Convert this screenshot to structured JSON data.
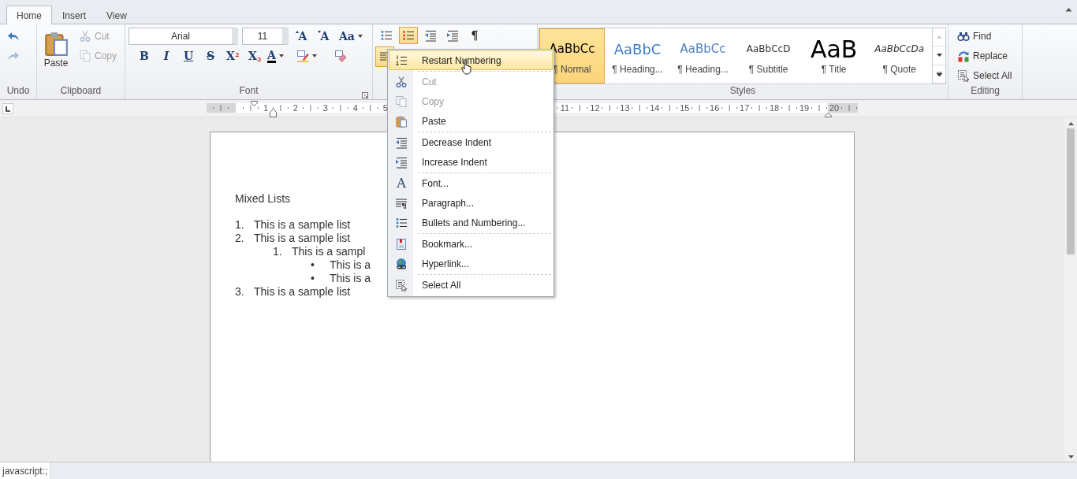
{
  "tabs": [
    {
      "label": "Home",
      "selected": true
    },
    {
      "label": "Insert",
      "selected": false
    },
    {
      "label": "View",
      "selected": false
    }
  ],
  "ribbon": {
    "undo": {
      "label": "Undo",
      "buttons": [
        {
          "kind": "undo",
          "disabled": false
        },
        {
          "kind": "redo",
          "disabled": true
        }
      ]
    },
    "clipboard": {
      "label": "Clipboard",
      "paste": {
        "label": "Paste"
      },
      "buttons": [
        {
          "kind": "cut",
          "label": "Cut",
          "disabled": true
        },
        {
          "kind": "copy",
          "label": "Copy",
          "disabled": true
        }
      ]
    },
    "font": {
      "label": "Font",
      "font_name": "Arial",
      "font_size": "11",
      "row1": [
        {
          "kind": "grow",
          "label": "A"
        },
        {
          "kind": "shrink",
          "label": "A"
        },
        {
          "kind": "case",
          "label": "Aa"
        }
      ],
      "row2": [
        {
          "kind": "bold",
          "label": "B"
        },
        {
          "kind": "italic",
          "label": "I"
        },
        {
          "kind": "underline",
          "label": "U"
        },
        {
          "kind": "strike",
          "label": "S"
        },
        {
          "kind": "super",
          "label": "X$^{2}$"
        },
        {
          "kind": "sub",
          "label": "X$_{2}$"
        },
        {
          "kind": "color",
          "label": "A"
        },
        {
          "kind": "highlight"
        },
        {
          "kind": "clear"
        }
      ]
    },
    "paragraph": {
      "row1": [
        {
          "kind": "bullets",
          "selected": false
        },
        {
          "kind": "numbering",
          "selected": true
        },
        {
          "kind": "outdent",
          "selected": false
        },
        {
          "kind": "indent",
          "selected": false
        },
        {
          "kind": "pilcrow",
          "label": "¶",
          "selected": false
        }
      ],
      "row2": [
        {
          "kind": "align-left",
          "selected": true
        }
      ]
    },
    "styles": {
      "label": "Styles",
      "items": [
        {
          "kind": "normal",
          "preview": "AaBbCc",
          "name": "¶ Normal",
          "selected": true
        },
        {
          "kind": "heading1",
          "preview": "AaBbC",
          "name": "¶ Heading...",
          "selected": false
        },
        {
          "kind": "heading2",
          "preview": "AaBbCc",
          "name": "¶ Heading...",
          "selected": false
        },
        {
          "kind": "subtitle",
          "preview": "AaBbCcD",
          "name": "¶ Subtitle",
          "selected": false
        },
        {
          "kind": "title",
          "preview": "AaB",
          "name": "¶ Title",
          "selected": false
        },
        {
          "kind": "quote",
          "preview": "AaBbCcDa",
          "name": "¶ Quote",
          "selected": false
        }
      ]
    },
    "editing": {
      "label": "Editing",
      "buttons": [
        {
          "kind": "find",
          "label": "Find"
        },
        {
          "kind": "replace",
          "label": "Replace"
        },
        {
          "kind": "selectall",
          "label": "Select All"
        }
      ]
    }
  },
  "ruler": {
    "left_numbers": [
      "1",
      "2",
      "3",
      "4",
      "5"
    ],
    "right_numbers": [
      "11",
      "12",
      "13",
      "14",
      "15",
      "16",
      "17",
      "18",
      "19",
      "20"
    ]
  },
  "document": {
    "title": "Mixed Lists",
    "list": [
      {
        "marker": "1.",
        "text": "This is a sample list"
      },
      {
        "marker": "2.",
        "text": "This is a sample list",
        "children": [
          {
            "marker": "1.",
            "text": "This is a sampl",
            "children": [
              {
                "marker": "•",
                "text": "This is a"
              },
              {
                "marker": "•",
                "text": "This is a"
              }
            ]
          }
        ]
      },
      {
        "marker": "3.",
        "text": "This is a sample list"
      }
    ]
  },
  "context_menu": {
    "items": [
      {
        "kind": "restart",
        "label": "Restart Numbering",
        "selected": true,
        "disabled": false,
        "separator_above": false
      },
      {
        "kind": "cut",
        "label": "Cut",
        "selected": false,
        "disabled": true,
        "separator_above": true
      },
      {
        "kind": "copy",
        "label": "Copy",
        "selected": false,
        "disabled": true,
        "separator_above": false
      },
      {
        "kind": "paste",
        "label": "Paste",
        "selected": false,
        "disabled": false,
        "separator_above": false
      },
      {
        "kind": "outdent",
        "label": "Decrease Indent",
        "selected": false,
        "disabled": false,
        "separator_above": true
      },
      {
        "kind": "indent",
        "label": "Increase Indent",
        "selected": false,
        "disabled": false,
        "separator_above": false
      },
      {
        "kind": "font",
        "icon_glyph": "A",
        "label": "Font...",
        "selected": false,
        "disabled": false,
        "separator_above": true
      },
      {
        "kind": "paragraph",
        "label": "Paragraph...",
        "selected": false,
        "disabled": false,
        "separator_above": false
      },
      {
        "kind": "bullets",
        "label": "Bullets and Numbering...",
        "selected": false,
        "disabled": false,
        "separator_above": false
      },
      {
        "kind": "bookmark",
        "label": "Bookmark...",
        "selected": false,
        "disabled": false,
        "separator_above": true
      },
      {
        "kind": "hyperlink",
        "label": "Hyperlink...",
        "selected": false,
        "disabled": false,
        "separator_above": false
      },
      {
        "kind": "selectall",
        "label": "Select All",
        "selected": false,
        "disabled": false,
        "separator_above": true
      }
    ]
  },
  "status": {
    "text": "javascript:;"
  }
}
